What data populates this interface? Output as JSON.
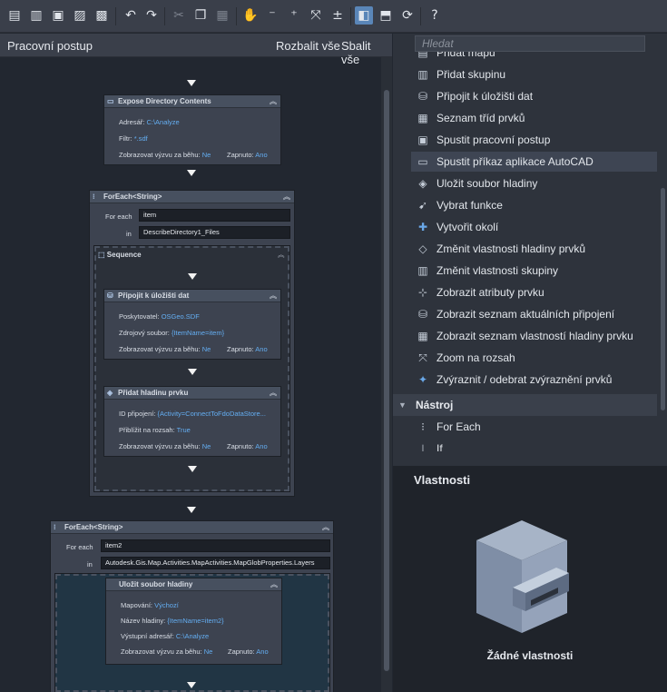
{
  "toolbar": {
    "buttons": [
      "new-icon",
      "open-icon",
      "save-icon",
      "save-as-icon",
      "save-all-icon",
      "undo-icon",
      "redo-icon",
      "cut-icon",
      "copy-icon",
      "paste-icon",
      "pan-icon",
      "zoom-out-icon",
      "zoom-in-icon",
      "zoom-extents-icon",
      "zoom-window-icon",
      "layout-vertical-icon",
      "layout-horizontal-icon",
      "refresh-icon",
      "help-icon"
    ]
  },
  "workflow": {
    "title": "Pracovní postup",
    "expand_all": "Rozbalit vše",
    "collapse_all": "Sbalit vše",
    "expose": {
      "title": "Expose Directory Contents",
      "address_label": "Adresář:",
      "address_value": "C:\\Analyze",
      "filter_label": "Filtr:",
      "filter_value": "*.sdf",
      "prompt_label": "Zobrazovat výzvu za běhu:",
      "prompt_value": "Ne",
      "enabled_label": "Zapnuto:",
      "enabled_value": "Ano"
    },
    "foreach1": {
      "title": "ForEach<String>",
      "foreach_label": "For each",
      "foreach_value": "item",
      "in_label": "in",
      "in_value": "DescribeDirectory1_Files",
      "sequence_title": "Sequence",
      "connect": {
        "title": "Připojit k úložišti dat",
        "provider_label": "Poskytovatel:",
        "provider_value": "OSGeo.SDF",
        "source_label": "Zdrojový soubor:",
        "source_value": "{ItemName=item}",
        "prompt_label": "Zobrazovat výzvu za běhu:",
        "prompt_value": "Ne",
        "enabled_label": "Zapnuto:",
        "enabled_value": "Ano"
      },
      "addlayer": {
        "title": "Přidat hladinu prvku",
        "conn_label": "ID připojení:",
        "conn_value": "{Activity=ConnectToFdoDataStore...",
        "zoom_label": "Přiblížit na rozsah:",
        "zoom_value": "True",
        "prompt_label": "Zobrazovat výzvu za běhu:",
        "prompt_value": "Ne",
        "enabled_label": "Zapnuto:",
        "enabled_value": "Ano"
      }
    },
    "foreach2": {
      "title": "ForEach<String>",
      "foreach_label": "For each",
      "foreach_value": "item2",
      "in_label": "in",
      "in_value": "Autodesk.Gis.Map.Activities.MapActivities.MapGlobProperties.Layers",
      "savelayer": {
        "title": "Uložit soubor hladiny",
        "mapping_label": "Mapování:",
        "mapping_value": "Výchozí",
        "name_label": "Název hladiny:",
        "name_value": "{ItemName=item2}",
        "out_label": "Výstupní adresář:",
        "out_value": "C:\\Analyze",
        "prompt_label": "Zobrazovat výzvu za běhu:",
        "prompt_value": "Ne",
        "enabled_label": "Zapnuto:",
        "enabled_value": "Ano"
      }
    }
  },
  "activities": {
    "search_placeholder": "Hledat",
    "items": [
      {
        "label": "Přidat mapu",
        "icon": "map-add-icon"
      },
      {
        "label": "Přidat skupinu",
        "icon": "group-add-icon"
      },
      {
        "label": "Připojit k úložišti dat",
        "icon": "database-icon"
      },
      {
        "label": "Seznam tříd prvků",
        "icon": "class-list-icon"
      },
      {
        "label": "Spustit pracovní postup",
        "icon": "run-workflow-icon"
      },
      {
        "label": "Spustit příkaz aplikace AutoCAD",
        "icon": "command-icon"
      },
      {
        "label": "Uložit soubor hladiny",
        "icon": "save-layer-icon"
      },
      {
        "label": "Vybrat funkce",
        "icon": "select-icon"
      },
      {
        "label": "Vytvořit okolí",
        "icon": "buffer-icon"
      },
      {
        "label": "Změnit vlastnosti hladiny prvků",
        "icon": "layer-props-icon"
      },
      {
        "label": "Změnit vlastnosti skupiny",
        "icon": "group-props-icon"
      },
      {
        "label": "Zobrazit atributy prvku",
        "icon": "attributes-icon"
      },
      {
        "label": "Zobrazit seznam aktuálních připojení",
        "icon": "connections-icon"
      },
      {
        "label": "Zobrazit seznam vlastností hladiny prvku",
        "icon": "layer-list-icon"
      },
      {
        "label": "Zoom na rozsah",
        "icon": "zoom-extents-icon"
      },
      {
        "label": "Zvýraznit / odebrat zvýraznění prvků",
        "icon": "highlight-icon"
      }
    ],
    "group_label": "Nástroj",
    "tool_items": [
      {
        "label": "For Each",
        "icon": "foreach-icon"
      },
      {
        "label": "If",
        "icon": "if-icon"
      }
    ]
  },
  "properties": {
    "title": "Vlastnosti",
    "empty_text": "Žádné vlastnosti"
  }
}
